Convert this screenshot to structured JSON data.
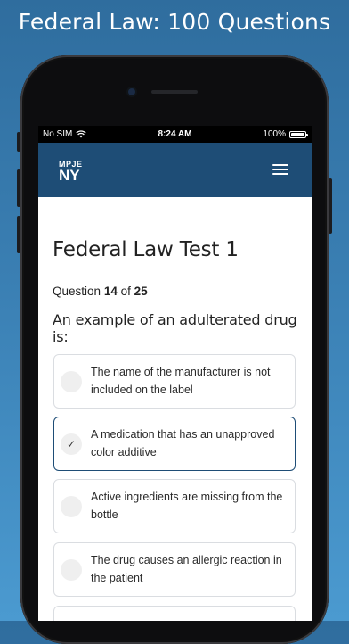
{
  "banner": {
    "title": "Federal Law: 100 Questions"
  },
  "status_bar": {
    "carrier": "No SIM",
    "time": "8:24 AM",
    "battery": "100%"
  },
  "navbar": {
    "logo_line1": "MPJE",
    "logo_line2": "NY"
  },
  "test": {
    "title": "Federal Law Test 1",
    "counter_prefix": "Question",
    "current": "14",
    "counter_sep": "of",
    "total": "25",
    "question": "An example of an adulterated drug is:"
  },
  "answers": [
    {
      "text": "The name of the manufacturer is not included on the label",
      "selected": false
    },
    {
      "text": "A medication that has an unapproved color additive",
      "selected": true,
      "mark": "✓"
    },
    {
      "text": "Active ingredients are missing from the bottle",
      "selected": false
    },
    {
      "text": "The drug causes an allergic reaction in the patient",
      "selected": false
    }
  ],
  "colors": {
    "navbar": "#1e4d76",
    "selected_border": "#1e4d76",
    "background_top": "#2f6d9e",
    "background_bottom": "#4b9ad0"
  },
  "icons": {
    "menu": "hamburger-menu-icon",
    "wifi": "wifi-icon",
    "battery": "battery-icon",
    "check": "check-icon"
  }
}
